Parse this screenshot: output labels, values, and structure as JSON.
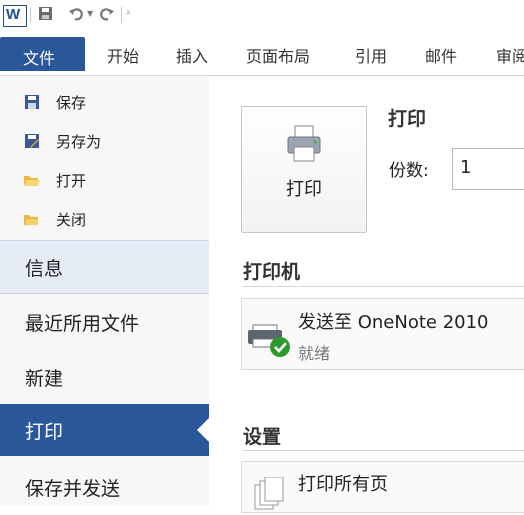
{
  "quick_access": {
    "app_logo": "W",
    "icons": [
      "save-icon",
      "undo-icon",
      "redo-icon",
      "customize-icon"
    ]
  },
  "tabs": [
    "文件",
    "开始",
    "插入",
    "页面布局",
    "引用",
    "邮件",
    "审阅"
  ],
  "backstage": {
    "commands": [
      "保存",
      "另存为",
      "打开",
      "关闭"
    ],
    "nav": [
      "信息",
      "最近所用文件",
      "新建",
      "打印",
      "保存并发送"
    ],
    "active": "打印"
  },
  "print": {
    "button_label": "打印",
    "heading": "打印",
    "copies_label": "份数:",
    "copies_value": "1"
  },
  "printer": {
    "heading": "打印机",
    "name": "发送至 OneNote 2010",
    "status": "就绪"
  },
  "settings": {
    "heading": "设置",
    "pages": "打印所有页"
  },
  "colors": {
    "accent": "#2a579a",
    "ready": "#2e9a2e"
  }
}
